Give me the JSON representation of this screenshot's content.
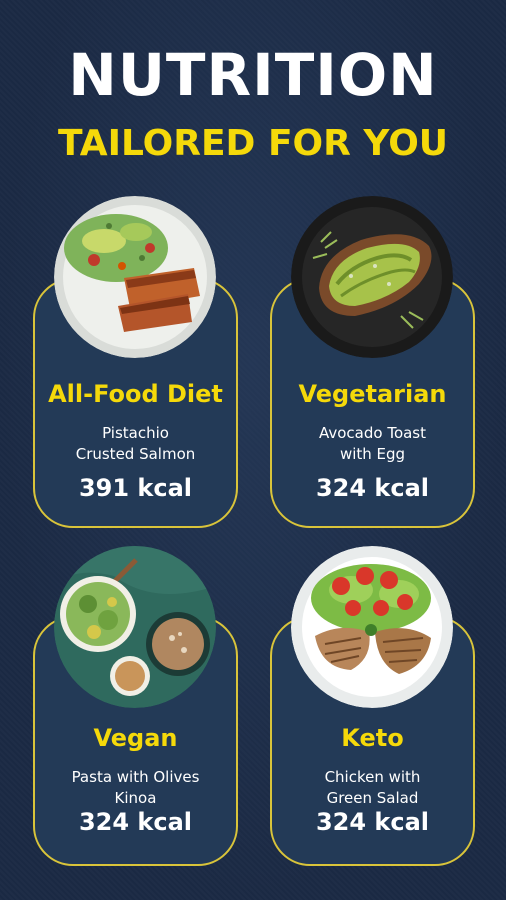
{
  "header": {
    "title": "NUTRITION",
    "subtitle": "TAILORED FOR YOU"
  },
  "colors": {
    "background": "#1b2a44",
    "card": "#233a57",
    "accent": "#f5d90a",
    "text": "#ffffff"
  },
  "cards": [
    {
      "diet": "All-Food Diet",
      "meal": "Pistachio\nCrusted Salmon",
      "kcal": "391 kcal",
      "image_icon": "salmon-plate-icon"
    },
    {
      "diet": "Vegetarian",
      "meal": "Avocado Toast\nwith Egg",
      "kcal": "324 kcal",
      "image_icon": "avocado-toast-icon"
    },
    {
      "diet": "Vegan",
      "meal": "Pasta with Olives\nKinoa",
      "kcal": "324 kcal",
      "image_icon": "vegan-bowls-icon"
    },
    {
      "diet": "Keto",
      "meal": "Chicken with\nGreen Salad",
      "kcal": "324 kcal",
      "image_icon": "chicken-salad-icon"
    }
  ]
}
